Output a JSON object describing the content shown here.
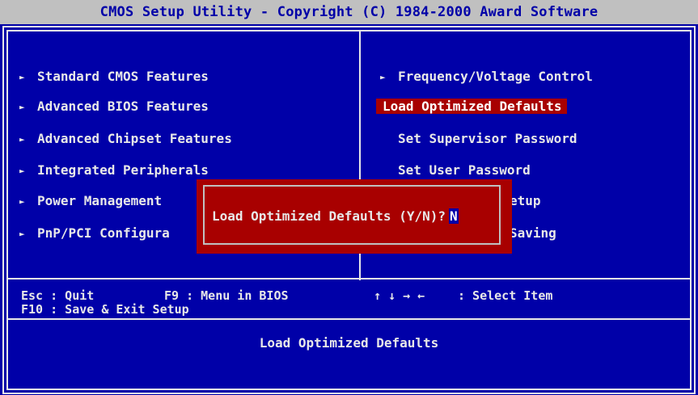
{
  "title": "CMOS Setup Utility - Copyright (C) 1984-2000 Award Software",
  "left_menu": [
    {
      "label": "Standard CMOS Features"
    },
    {
      "label": "Advanced BIOS Features"
    },
    {
      "label": "Advanced Chipset Features"
    },
    {
      "label": "Integrated Peripherals"
    },
    {
      "label": "Power Management"
    },
    {
      "label": "PnP/PCI Configura"
    }
  ],
  "right_menu": [
    {
      "label": "Frequency/Voltage Control"
    },
    {
      "label": "Load Optimized Defaults"
    },
    {
      "label": "Set Supervisor Password"
    },
    {
      "label": "Set User Password"
    },
    {
      "label": "etup"
    },
    {
      "label": "Saving"
    }
  ],
  "submenu_marker": "►",
  "help": {
    "esc_key": "Esc : Quit",
    "f9_key": "F9 : Menu in BIOS",
    "arrows": "↑ ↓ → ←",
    "select_item": ": Select Item",
    "f10_key": "F10 : Save & Exit Setup"
  },
  "status_text": "Load Optimized Defaults",
  "dialog": {
    "prompt": "Load Optimized Defaults (Y/N)?",
    "answer": "N"
  },
  "colors": {
    "background": "#0000a8",
    "title_bar": "#c0c0c0",
    "highlight": "#a80000",
    "text": "#e8e8e8"
  }
}
